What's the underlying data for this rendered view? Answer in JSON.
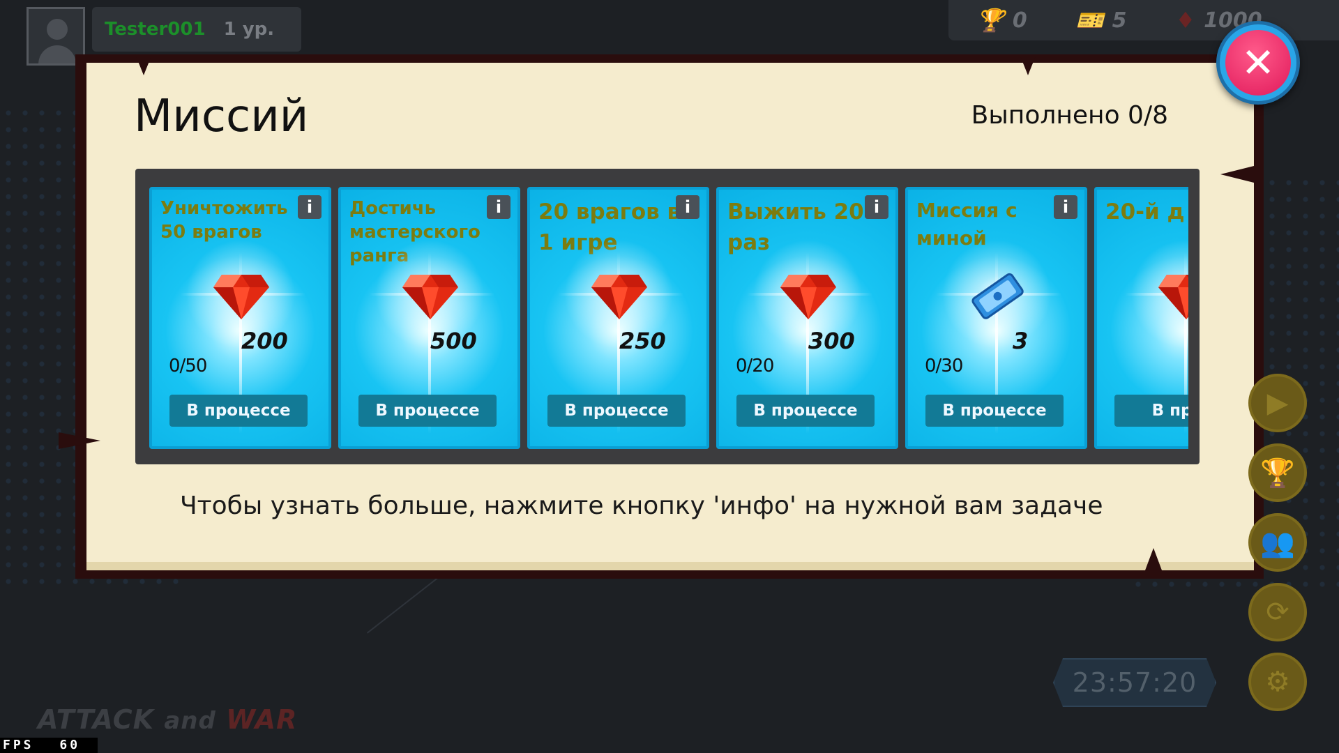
{
  "player": {
    "name": "Tester001",
    "level": "1 ур."
  },
  "currencies": [
    {
      "icon": "trophy-icon",
      "glyph": "🏆",
      "value": "0"
    },
    {
      "icon": "ticket-icon",
      "glyph": "🎫",
      "value": "5"
    },
    {
      "icon": "gem-icon",
      "glyph": "♦",
      "value": "1000"
    }
  ],
  "close_label": "✕",
  "modal": {
    "title": "Миссий",
    "completed": "Выполнено 0/8",
    "hint": "Чтобы узнать больше, нажмите кнопку 'инфо' на нужной вам задаче"
  },
  "missions": [
    {
      "title": "Уничтожить 50 врагов",
      "reward_type": "gem",
      "reward": "200",
      "progress": "0/50",
      "status": "В процессе",
      "info": "i"
    },
    {
      "title": "Достичь мастерского ранга",
      "reward_type": "gem",
      "reward": "500",
      "progress": "",
      "status": "В процессе",
      "info": "i"
    },
    {
      "title": "20 врагов в 1 игре",
      "reward_type": "gem",
      "reward": "250",
      "progress": "",
      "status": "В процессе",
      "info": "i"
    },
    {
      "title": "Выжить 20 раз",
      "reward_type": "gem",
      "reward": "300",
      "progress": "0/20",
      "status": "В процессе",
      "info": "i"
    },
    {
      "title": "Миссия с миной",
      "reward_type": "ticket",
      "reward": "3",
      "progress": "0/30",
      "status": "В процессе",
      "info": "i"
    },
    {
      "title": "20-й д",
      "reward_type": "gem",
      "reward": "",
      "progress": "",
      "status": "В проц",
      "info": ""
    }
  ],
  "timer": "23:57:20",
  "logo": {
    "part1": "ATTACK",
    "part2": "and",
    "part3": "WAR"
  },
  "fps": {
    "label": "FPS",
    "value": "60"
  },
  "colors": {
    "card": "#18c4f3",
    "status_button": "#127a96",
    "close": "#e0195a",
    "panel": "#f5ecce"
  }
}
